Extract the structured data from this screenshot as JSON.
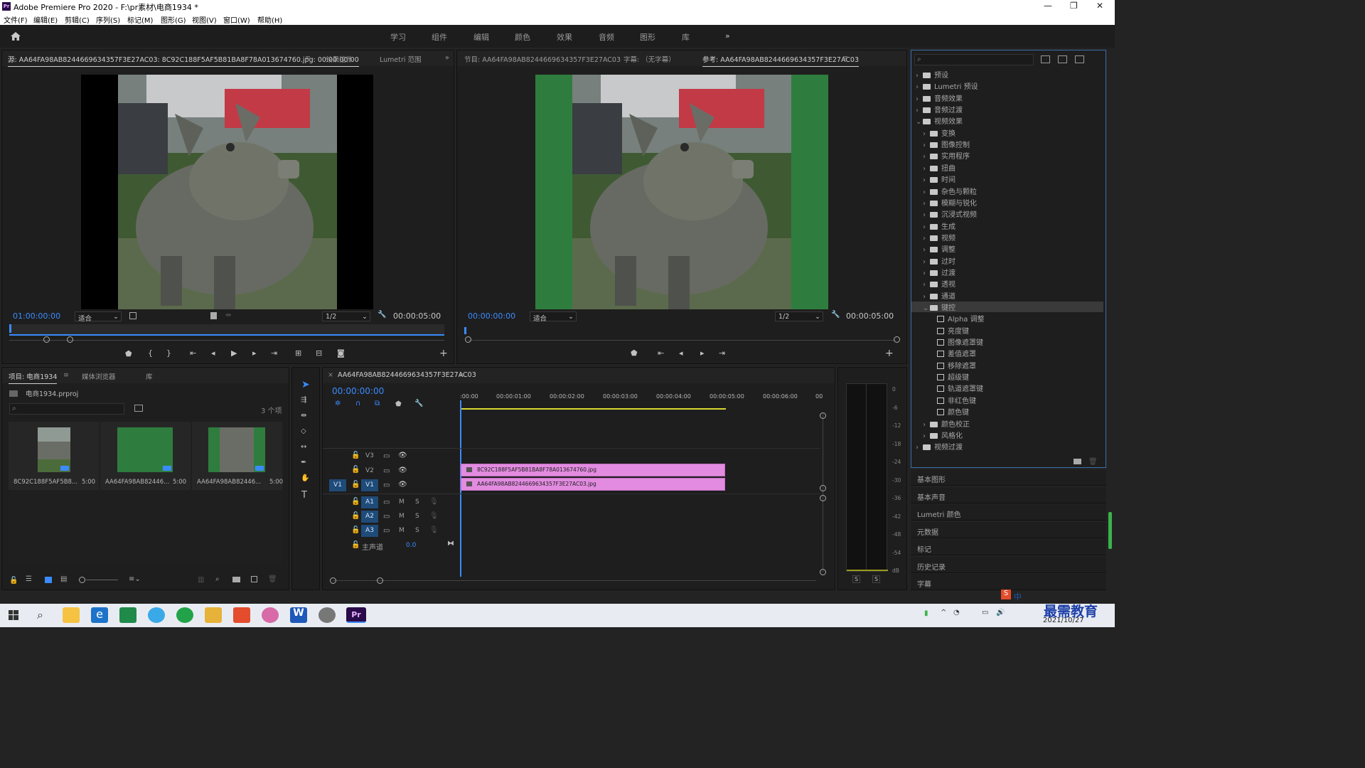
{
  "window": {
    "title": "Adobe Premiere Pro 2020 - F:\\pr素材\\电商1934 *",
    "app_icon": "Pr"
  },
  "menu": [
    "文件(F)",
    "编辑(E)",
    "剪辑(C)",
    "序列(S)",
    "标记(M)",
    "图形(G)",
    "视图(V)",
    "窗口(W)",
    "帮助(H)"
  ],
  "workspaces": [
    "学习",
    "组件",
    "编辑",
    "颜色",
    "效果",
    "音频",
    "图形",
    "库"
  ],
  "source": {
    "tabs": [
      "源: AA64FA98AB8244669634357F3E27AC03: 8C92C188F5AF5B81BA8F78A013674760.jpg: 00:00:00:00",
      "效果控件",
      "Lumetri 范围"
    ],
    "timecode": "01:00:00:00",
    "fit": "适合",
    "res": "1/2",
    "duration": "00:00:05:00"
  },
  "program": {
    "tabs": [
      "节目: AA64FA98AB8244669634357F3E27AC03",
      "字幕: （无字幕）",
      "参考: AA64FA98AB8244669634357F3E27AC03"
    ],
    "timecode": "00:00:00:00",
    "fit": "适合",
    "res": "1/2",
    "duration": "00:00:05:00"
  },
  "effects": {
    "search_placeholder": "",
    "items": [
      {
        "label": "预设",
        "level": 0,
        "icon": "preset-folder"
      },
      {
        "label": "Lumetri 预设",
        "level": 0,
        "icon": "preset-folder"
      },
      {
        "label": "音频效果",
        "level": 0,
        "icon": "folder"
      },
      {
        "label": "音频过渡",
        "level": 0,
        "icon": "folder"
      },
      {
        "label": "视频效果",
        "level": 0,
        "icon": "folder",
        "open": true
      },
      {
        "label": "变换",
        "level": 1,
        "icon": "folder"
      },
      {
        "label": "图像控制",
        "level": 1,
        "icon": "folder"
      },
      {
        "label": "实用程序",
        "level": 1,
        "icon": "folder"
      },
      {
        "label": "扭曲",
        "level": 1,
        "icon": "folder"
      },
      {
        "label": "时间",
        "level": 1,
        "icon": "folder"
      },
      {
        "label": "杂色与颗粒",
        "level": 1,
        "icon": "folder"
      },
      {
        "label": "模糊与锐化",
        "level": 1,
        "icon": "folder"
      },
      {
        "label": "沉浸式视频",
        "level": 1,
        "icon": "folder"
      },
      {
        "label": "生成",
        "level": 1,
        "icon": "folder"
      },
      {
        "label": "视频",
        "level": 1,
        "icon": "folder"
      },
      {
        "label": "调整",
        "level": 1,
        "icon": "folder"
      },
      {
        "label": "过时",
        "level": 1,
        "icon": "folder"
      },
      {
        "label": "过渡",
        "level": 1,
        "icon": "folder"
      },
      {
        "label": "透视",
        "level": 1,
        "icon": "folder"
      },
      {
        "label": "通道",
        "level": 1,
        "icon": "folder"
      },
      {
        "label": "键控",
        "level": 1,
        "icon": "folder",
        "open": true,
        "selected": true
      },
      {
        "label": "Alpha 调整",
        "level": 2,
        "icon": "effect"
      },
      {
        "label": "亮度键",
        "level": 2,
        "icon": "effect"
      },
      {
        "label": "图像遮罩键",
        "level": 2,
        "icon": "effect"
      },
      {
        "label": "差值遮罩",
        "level": 2,
        "icon": "effect"
      },
      {
        "label": "移除遮罩",
        "level": 2,
        "icon": "effect"
      },
      {
        "label": "超级键",
        "level": 2,
        "icon": "effect"
      },
      {
        "label": "轨道遮罩键",
        "level": 2,
        "icon": "effect"
      },
      {
        "label": "非红色键",
        "level": 2,
        "icon": "effect"
      },
      {
        "label": "颜色键",
        "level": 2,
        "icon": "effect"
      },
      {
        "label": "颜色校正",
        "level": 1,
        "icon": "folder"
      },
      {
        "label": "风格化",
        "level": 1,
        "icon": "folder"
      },
      {
        "label": "视频过渡",
        "level": 0,
        "icon": "folder"
      }
    ]
  },
  "side_panels": [
    "基本图形",
    "基本声音",
    "Lumetri 颜色",
    "元数据",
    "标记",
    "历史记录",
    "字幕"
  ],
  "project": {
    "tabs": [
      "项目: 电商1934",
      "媒体浏览器",
      "库"
    ],
    "file": "电商1934.prproj",
    "count": "3 个项",
    "items": [
      {
        "name": "8C92C188F5AF5B8...",
        "dur": "5:00",
        "kind": "pig"
      },
      {
        "name": "AA64FA98AB82446...",
        "dur": "5:00",
        "kind": "green"
      },
      {
        "name": "AA64FA98AB82446...",
        "dur": "5:00",
        "kind": "pig"
      }
    ]
  },
  "timeline": {
    "tab": "AA64FA98AB8244669634357F3E27AC03",
    "timecode": "00:00:00:00",
    "ruler": [
      ":00:00",
      "00:00:01:00",
      "00:00:02:00",
      "00:00:03:00",
      "00:00:04:00",
      "00:00:05:00",
      "00:00:06:00",
      "00"
    ],
    "video_tracks": [
      "V3",
      "V2",
      "V1"
    ],
    "audio_tracks": [
      "A1",
      "A2",
      "A3"
    ],
    "src_v": "V1",
    "master": "主声道",
    "master_val": "0.0",
    "clips": [
      {
        "track": "V2",
        "name": "8C92C188F5AF5B81BA8F78A013674760.jpg"
      },
      {
        "track": "V1",
        "name": "AA64FA98AB8244669634357F3E27AC03.jpg"
      }
    ]
  },
  "meter": {
    "scale": [
      "0",
      "-6",
      "-12",
      "-18",
      "-24",
      "-30",
      "-36",
      "-42",
      "-48",
      "-54",
      "dB"
    ],
    "solo": [
      "S",
      "S"
    ]
  },
  "taskbar": {
    "date": "2021/10/27",
    "ime": "中",
    "watermark": "最需教育"
  },
  "colors": {
    "accent": "#3b8bff",
    "clip": "#e28be0",
    "green": "#2e7d3e"
  }
}
